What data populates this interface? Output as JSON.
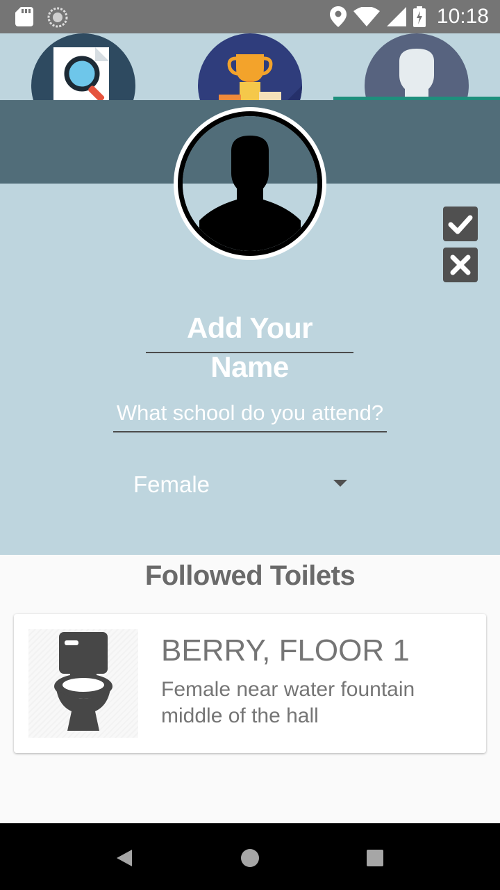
{
  "status_bar": {
    "time": "10:18",
    "icons": [
      "sd-card-icon",
      "sync-icon",
      "location-icon",
      "wifi-icon",
      "signal-icon",
      "battery-charging-icon"
    ]
  },
  "tabs": [
    {
      "name": "search",
      "icon": "search-document-icon",
      "selected": false
    },
    {
      "name": "leaderboard",
      "icon": "trophy-podium-icon",
      "selected": false
    },
    {
      "name": "profile",
      "icon": "user-silhouette-icon",
      "selected": true
    }
  ],
  "profile": {
    "avatar_icon": "user-silhouette-icon",
    "name_placeholder": "Add Your Name",
    "school_placeholder": "What school do you attend?",
    "gender_value": "Female",
    "confirm_icon": "check-icon",
    "cancel_icon": "close-icon"
  },
  "followed": {
    "section_title": "Followed Toilets",
    "items": [
      {
        "title": "BERRY, FLOOR 1",
        "description": "Female near water fountain middle of the hall",
        "icon": "toilet-icon"
      }
    ]
  },
  "nav_bar": {
    "buttons": [
      "back-icon",
      "home-icon",
      "recents-icon"
    ]
  },
  "colors": {
    "status_bar": "#757575",
    "panel": "#bed5de",
    "header_band": "#516d79",
    "tab_indicator": "#1f8f7d",
    "action_button": "#505050",
    "text_gray": "#757575"
  }
}
